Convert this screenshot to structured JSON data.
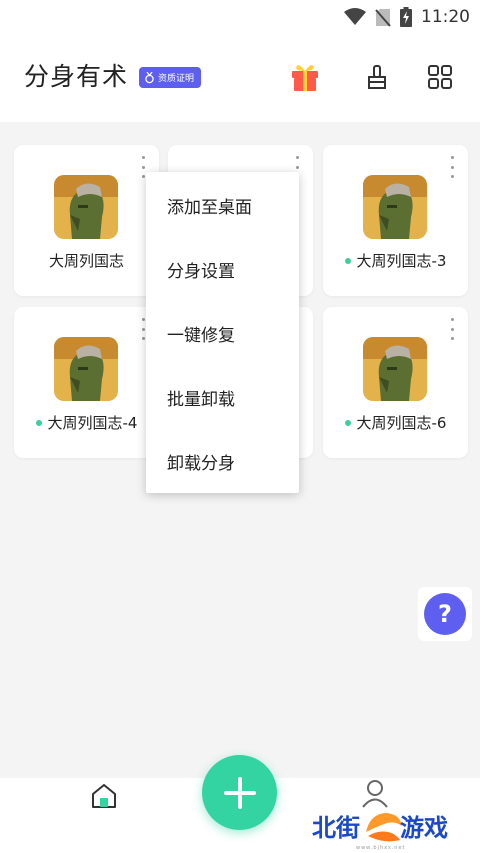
{
  "status_bar": {
    "time": "11:20"
  },
  "header": {
    "title": "分身有术",
    "badge": "资质证明"
  },
  "apps": [
    {
      "name": "大周列国志",
      "running": false
    },
    {
      "name": "大周列国志-3",
      "running": true
    },
    {
      "name": "大周列国志-4",
      "running": true
    },
    {
      "name": "大周列国志-6",
      "running": true
    }
  ],
  "menu": {
    "items": [
      "添加至桌面",
      "分身设置",
      "一键修复",
      "批量卸载",
      "卸载分身"
    ]
  },
  "help": {
    "label": "?"
  },
  "watermark": {
    "left": "北街",
    "right": "游戏",
    "url": "www.bjhxs.net"
  },
  "colors": {
    "accent": "#5e5ef0",
    "fab": "#34d3a2",
    "running_dot": "#3ccf9a"
  }
}
